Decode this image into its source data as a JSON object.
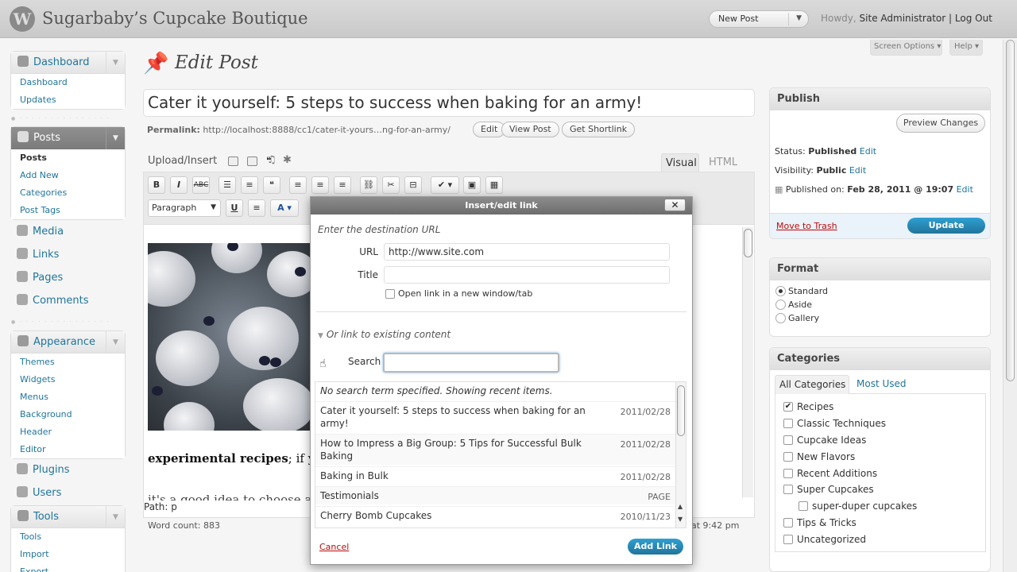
{
  "header": {
    "site_title": "Sugarbaby’s Cupcake Boutique",
    "new_post": "New Post",
    "howdy": "Howdy,",
    "user": "Site Administrator",
    "sep": "|",
    "logout": "Log Out"
  },
  "top_tabs": {
    "screen_options": "Screen Options ▾",
    "help": "Help ▾"
  },
  "menu": {
    "dashboard": {
      "label": "Dashboard",
      "items": [
        "Dashboard",
        "Updates"
      ]
    },
    "posts": {
      "label": "Posts",
      "items": [
        "Posts",
        "Add New",
        "Categories",
        "Post Tags"
      ]
    },
    "media": "Media",
    "links": "Links",
    "pages": "Pages",
    "comments": "Comments",
    "appearance": {
      "label": "Appearance",
      "items": [
        "Themes",
        "Widgets",
        "Menus",
        "Background",
        "Header",
        "Editor"
      ]
    },
    "plugins": "Plugins",
    "users": "Users",
    "tools": {
      "label": "Tools",
      "items": [
        "Tools",
        "Import",
        "Export"
      ]
    }
  },
  "main": {
    "page_title": "Edit Post",
    "post_title": "Cater it yourself: 5 steps to success when baking for an army!",
    "permalink_label": "Permalink:",
    "permalink_url": "http://localhost:8888/cc1/cater-it-yours…ng-for-an-army/",
    "buttons": [
      "Edit",
      "View Post",
      "Get Shortlink"
    ],
    "upload_insert": "Upload/Insert",
    "tab_visual": "Visual",
    "tab_html": "HTML",
    "format_select": "Paragraph",
    "content_bold": "experimental recipes",
    "content_rest": "; if y",
    "content_line2": "it's a good idea to choose a r",
    "path": "Path: p",
    "word_count": "Word count: 883",
    "last_edit": "at 9:42 pm"
  },
  "publish": {
    "title": "Publish",
    "preview": "Preview Changes",
    "status_label": "Status:",
    "status_value": "Published",
    "status_edit": "Edit",
    "visibility_label": "Visibility:",
    "visibility_value": "Public",
    "visibility_edit": "Edit",
    "published_label": "Published on:",
    "published_value": "Feb 28, 2011 @ 19:07",
    "published_edit": "Edit",
    "trash": "Move to Trash",
    "update": "Update"
  },
  "format": {
    "title": "Format",
    "options": [
      "Standard",
      "Aside",
      "Gallery"
    ],
    "selected": "Standard"
  },
  "categories": {
    "title": "Categories",
    "tab_all": "All Categories",
    "tab_most": "Most Used",
    "items": [
      "Recipes",
      "Classic Techniques",
      "Cupcake Ideas",
      "New Flavors",
      "Recent Additions",
      "Super Cupcakes",
      "super-duper cupcakes",
      "Tips & Tricks",
      "Uncategorized"
    ],
    "checked": [
      "Recipes"
    ]
  },
  "dialog": {
    "title": "Insert/edit link",
    "close": "✕",
    "instruction": "Enter the destination URL",
    "url_label": "URL",
    "url_value": "http://www.site.com",
    "title_label": "Title",
    "title_value": "",
    "new_window": "Open link in a new window/tab",
    "existing": "Or link to existing content",
    "search_label": "Search",
    "search_value": "",
    "note": "No search term specified. Showing recent items.",
    "results": [
      {
        "title": "Cater it yourself: 5 steps to success when baking for an army!",
        "date": "2011/02/28"
      },
      {
        "title": "How to Impress a Big Group: 5 Tips for Successful Bulk Baking",
        "date": "2011/02/28"
      },
      {
        "title": "Baking in Bulk",
        "date": "2011/02/28"
      },
      {
        "title": "Testimonials",
        "date": "PAGE"
      },
      {
        "title": "Cherry Bomb Cupcakes",
        "date": "2010/11/23"
      }
    ],
    "cancel": "Cancel",
    "add_link": "Add Link"
  },
  "colors": {
    "link": "#21759b",
    "primary_button": "#21759b",
    "trash": "#bc0b0b"
  }
}
